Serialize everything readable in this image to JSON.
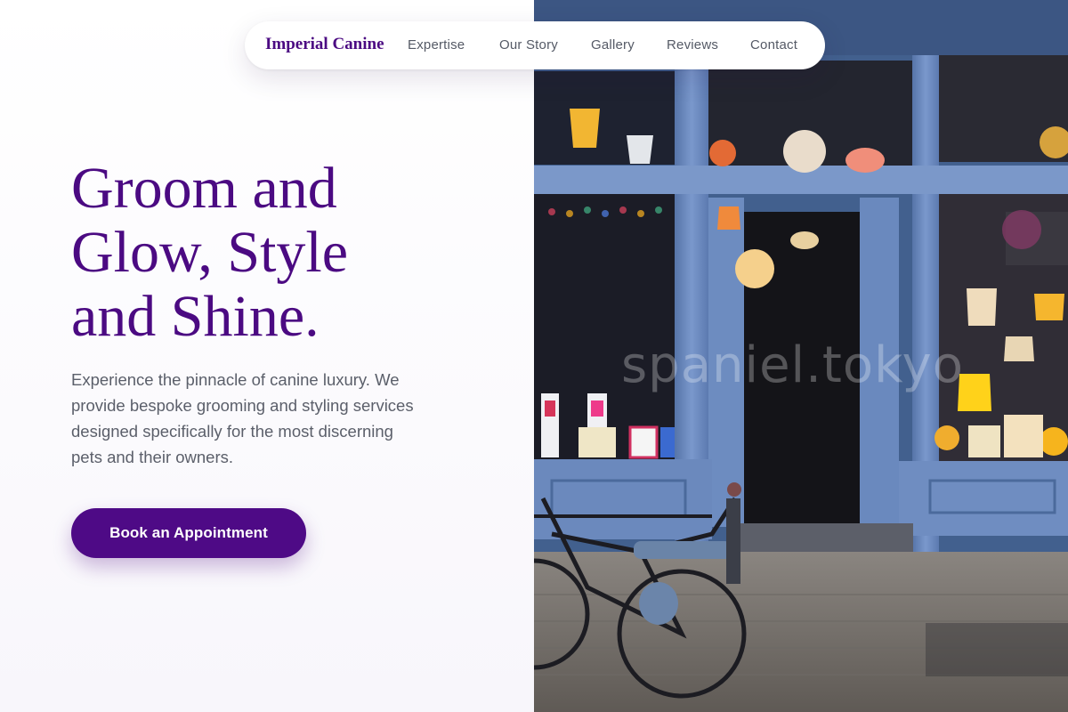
{
  "nav": {
    "brand": "Imperial Canine",
    "links": [
      "Expertise",
      "Our Story",
      "Gallery",
      "Reviews",
      "Contact"
    ]
  },
  "hero": {
    "title_lines": [
      "Groom and",
      "Glow, Style",
      "and Shine."
    ],
    "subtitle_lines": [
      "Experience the pinnacle of canine luxury. We",
      "provide bespoke grooming and styling services",
      "designed specifically for the most discerning",
      "pets and their owners."
    ],
    "cta_label": "Book an Appointment"
  },
  "photo": {
    "watermark": "spaniel.tokyo"
  },
  "colors": {
    "brand": "#4b0a82",
    "button": "#4e0a86",
    "body_text": "#5b5f6a",
    "storefront": "#6f8fc4"
  }
}
